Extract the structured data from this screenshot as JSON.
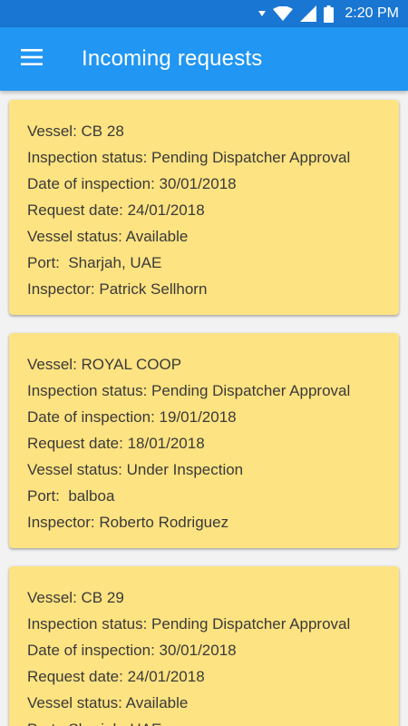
{
  "status_bar": {
    "time": "2:20 PM",
    "icons": [
      "signal-arrow-icon",
      "wifi-icon",
      "cellular-icon",
      "battery-icon"
    ]
  },
  "app_bar": {
    "title": "Incoming requests",
    "menu_icon": "hamburger-menu-icon"
  },
  "colors": {
    "status_bar": "#1976d2",
    "app_bar": "#2196f3",
    "card": "#fde381",
    "background": "#f2f2f2",
    "text": "#3a3a3a"
  },
  "requests": [
    {
      "vessel": "Vessel: CB 28",
      "inspection_status": "Inspection status: Pending Dispatcher Approval",
      "date_of_inspection": "Date of inspection: 30/01/2018",
      "request_date": "Request date: 24/01/2018",
      "vessel_status": "Vessel status: Available",
      "port": "Port:  Sharjah, UAE",
      "inspector": "Inspector: Patrick Sellhorn"
    },
    {
      "vessel": "Vessel: ROYAL COOP",
      "inspection_status": "Inspection status: Pending Dispatcher Approval",
      "date_of_inspection": "Date of inspection: 19/01/2018",
      "request_date": "Request date: 18/01/2018",
      "vessel_status": "Vessel status: Under Inspection",
      "port": "Port:  balboa",
      "inspector": "Inspector: Roberto Rodriguez"
    },
    {
      "vessel": "Vessel: CB 29",
      "inspection_status": "Inspection status: Pending Dispatcher Approval",
      "date_of_inspection": "Date of inspection: 30/01/2018",
      "request_date": "Request date: 24/01/2018",
      "vessel_status": "Vessel status: Available",
      "port": "Port:  Sharjah, UAE",
      "inspector": ""
    }
  ]
}
